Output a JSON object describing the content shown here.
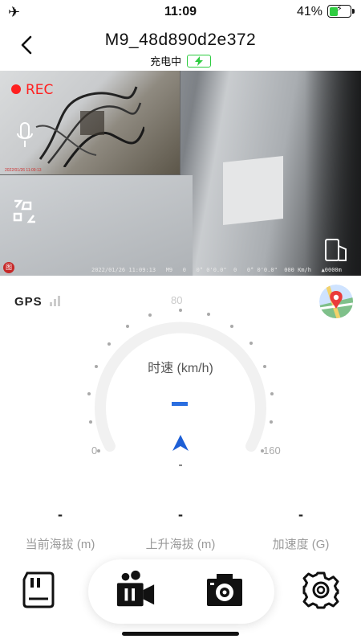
{
  "status_bar": {
    "time": "11:09",
    "battery_percent": "41%",
    "battery_level": 0.41,
    "airplane_icon": "airplane-icon"
  },
  "header": {
    "title": "M9_48d890d2e372",
    "subtitle": "充电中",
    "back_icon": "chevron-left-icon"
  },
  "camera": {
    "rec_label": "REC",
    "pip_info": "2022/01/26 11:09:13",
    "overlay_text": "2022/01/26 11:09:13   M9   0   0° 0'0.0\"  0   0° 0'0.0\"  000 Km/h   ▲0000m",
    "logo_text": "图"
  },
  "gps": {
    "label": "GPS",
    "signal_bars": 0
  },
  "speed": {
    "unit_label": "时速 (km/h)",
    "value": "-",
    "min_label": "0",
    "mid_label": "80",
    "max_label": "160",
    "heading_value": "-"
  },
  "stats": [
    {
      "value": "-",
      "label": "当前海拔 (m)"
    },
    {
      "value": "-",
      "label": "上升海拔 (m)"
    },
    {
      "value": "-",
      "label": "加速度 (G)"
    }
  ],
  "colors": {
    "accent": "#2a6ee0",
    "rec": "#ff2020",
    "charging": "#2ecc40"
  }
}
